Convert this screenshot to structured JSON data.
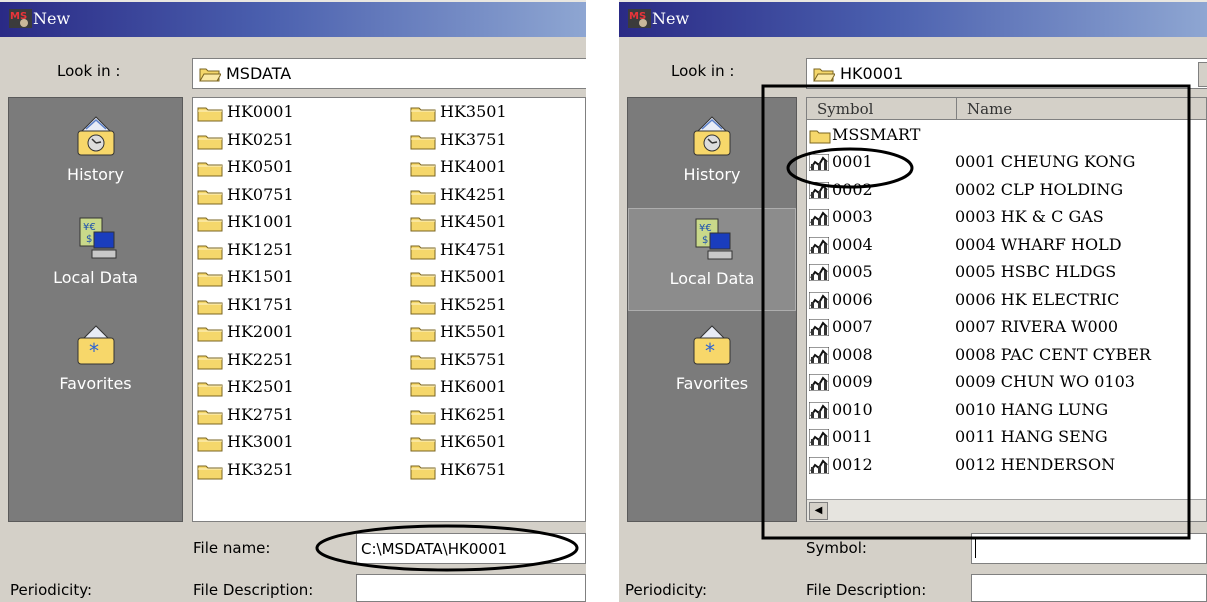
{
  "left_dialog": {
    "title": "New",
    "look_in_label": "Look in :",
    "look_in_value": "MSDATA",
    "places": [
      {
        "label": "History",
        "icon": "history-icon"
      },
      {
        "label": "Local Data",
        "icon": "local-data-icon"
      },
      {
        "label": "Favorites",
        "icon": "favorites-icon"
      }
    ],
    "folders_col1": [
      "HK0001",
      "HK0251",
      "HK0501",
      "HK0751",
      "HK1001",
      "HK1251",
      "HK1501",
      "HK1751",
      "HK2001",
      "HK2251",
      "HK2501",
      "HK2751",
      "HK3001",
      "HK3251"
    ],
    "folders_col2": [
      "HK3501",
      "HK3751",
      "HK4001",
      "HK4251",
      "HK4501",
      "HK4751",
      "HK5001",
      "HK5251",
      "HK5501",
      "HK5751",
      "HK6001",
      "HK6251",
      "HK6501",
      "HK6751"
    ],
    "file_name_label": "File name:",
    "file_name_value": "C:\\MSDATA\\HK0001",
    "periodicity_label": "Periodicity:",
    "file_description_label": "File Description:"
  },
  "right_dialog": {
    "title": "New",
    "look_in_label": "Look in :",
    "look_in_value": "HK0001",
    "places": [
      {
        "label": "History",
        "icon": "history-icon"
      },
      {
        "label": "Local Data",
        "icon": "local-data-icon"
      },
      {
        "label": "Favorites",
        "icon": "favorites-icon"
      }
    ],
    "columns": [
      "Symbol",
      "Name"
    ],
    "subfolder": "MSSMART",
    "rows": [
      {
        "symbol": "0001",
        "name": "0001 CHEUNG KONG"
      },
      {
        "symbol": "0002",
        "name": "0002 CLP HOLDING"
      },
      {
        "symbol": "0003",
        "name": "0003 HK & C GAS"
      },
      {
        "symbol": "0004",
        "name": "0004 WHARF HOLD"
      },
      {
        "symbol": "0005",
        "name": "0005 HSBC HLDGS"
      },
      {
        "symbol": "0006",
        "name": "0006 HK ELECTRIC"
      },
      {
        "symbol": "0007",
        "name": "0007 RIVERA W000"
      },
      {
        "symbol": "0008",
        "name": "0008 PAC CENT CYBER"
      },
      {
        "symbol": "0009",
        "name": "0009 CHUN WO 0103"
      },
      {
        "symbol": "0010",
        "name": "0010 HANG LUNG"
      },
      {
        "symbol": "0011",
        "name": "0011 HANG SENG"
      },
      {
        "symbol": "0012",
        "name": "0012 HENDERSON"
      }
    ],
    "symbol_label": "Symbol:",
    "symbol_value": "",
    "periodicity_label": "Periodicity:",
    "file_description_label": "File Description:"
  },
  "colors": {
    "titlebar_start": "#2a2a85",
    "titlebar_end": "#8ea6d2",
    "dialog_bg": "#d4d0c8",
    "places_bg": "#7b7b7b",
    "folder_yellow": "#f5d76b",
    "annotation": "#000000"
  }
}
